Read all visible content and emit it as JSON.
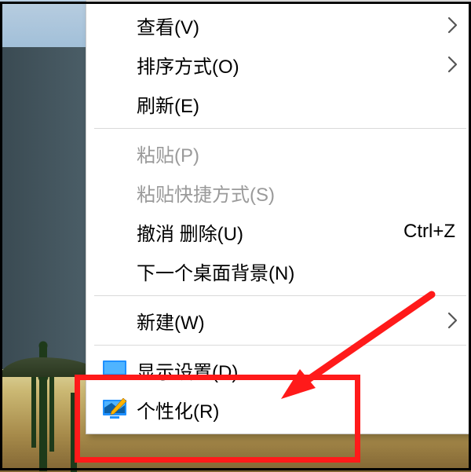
{
  "menu": {
    "view": "查看(V)",
    "sort": "排序方式(O)",
    "refresh": "刷新(E)",
    "paste": "粘贴(P)",
    "pasteShortcut": "粘贴快捷方式(S)",
    "undo": "撤消 删除(U)",
    "undoKey": "Ctrl+Z",
    "nextBg": "下一个桌面背景(N)",
    "new": "新建(W)",
    "display": "显示设置(D)",
    "personalize": "个性化(R)"
  }
}
